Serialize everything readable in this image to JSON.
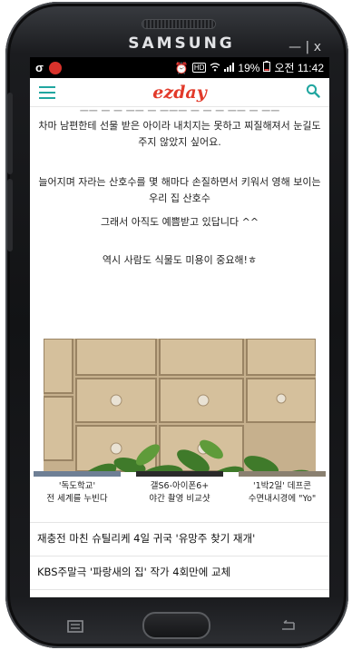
{
  "device": {
    "brand": "SAMSUNG",
    "window_controls": "— | x"
  },
  "status_bar": {
    "left_icons": [
      "sigma-icon",
      "notification-badge-icon"
    ],
    "right_icons": [
      "alarm-icon",
      "hd-icon",
      "wifi-icon",
      "signal-icon",
      "battery-icon"
    ],
    "battery": "19%",
    "time": "오전 11:42"
  },
  "app_bar": {
    "logo": "ezday",
    "menu_icon": "hamburger-menu-icon",
    "search_icon": "search-icon",
    "accent_color": "#21a6a0",
    "logo_color": "#e23a2a"
  },
  "article": {
    "cut_line": "ㅡㅡ ㅡ  ㅡ ㅡㅡ ㅡ ㅡㅡㅡ ㅡ ㅡ ㅡ ㅡㅡ ㅡ ㅡㅡ",
    "paragraphs": [
      "차마 남편한테 선물 받은 아이라 내치지는 못하고 찌질해져서 눈길도 주지 않았지 싶어요.",
      "늘어지며 자라는 산호수를 몇 해마다 손질하면서 키워서 영해 보이는 우리 집 산호수",
      "그래서 아직도 예쁨받고 있답니다 ^^",
      "역시 사람도 식물도 미용이 중요해!ㅎ"
    ],
    "photo": "wooden-drawers-with-green-plant"
  },
  "related": [
    {
      "line1": "'독도학교'",
      "line2": "전 세계를 누빈다"
    },
    {
      "line1": "갤S6-아이폰6+",
      "line2": "야간 촬영 비교샷"
    },
    {
      "line1": "'1박2일' 데프콘",
      "line2": "수면내시경에 \"Yo\""
    }
  ],
  "news": [
    "재충전 마친 슈틸리케 4일 귀국 '유망주 찾기 재개'",
    "KBS주말극 '파랑새의 집' 작가 4회만에 교체"
  ],
  "soft_keys": [
    "menu-icon",
    "home-button",
    "back-icon"
  ]
}
